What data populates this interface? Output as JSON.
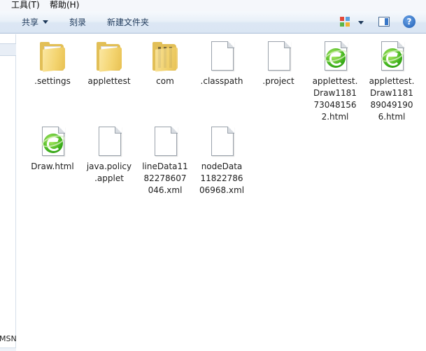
{
  "menu": {
    "tools": "工具(T)",
    "help": "帮助(H)"
  },
  "toolbar": {
    "share": "共享",
    "burn": "刻录",
    "new_folder": "新建文件夹"
  },
  "nav": {
    "msn_label": "MSN"
  },
  "files": [
    {
      "name": ".settings",
      "type": "folder"
    },
    {
      "name": "applettest",
      "type": "folder"
    },
    {
      "name": "com",
      "type": "folder"
    },
    {
      "name": ".classpath",
      "type": "doc"
    },
    {
      "name": ".project",
      "type": "doc"
    },
    {
      "name": "applettest.Draw11817304815 62.html",
      "display": "applettest.\nDraw1181\n73048156\n2.html",
      "type": "html"
    },
    {
      "name": "applettest.Draw11818904919 06.html",
      "display": "applettest.\nDraw1181\n89049190\n6.html",
      "type": "html"
    },
    {
      "name": "Draw.html",
      "type": "html"
    },
    {
      "name": "java.policy.applet",
      "display": "java.policy\n.applet",
      "type": "doc"
    },
    {
      "name": "lineData1182278607046.xml",
      "display": "lineData11\n82278607\n046.xml",
      "type": "doc"
    },
    {
      "name": "nodeData1182278606968.xml",
      "display": "nodeData\n11822786\n06968.xml",
      "type": "doc"
    }
  ],
  "icons": {
    "views": "views-icon",
    "preview_pane": "preview-pane-icon",
    "help": "help-icon"
  },
  "colors": {
    "toolbar_text": "#1e395b",
    "folder": "#f3d36e",
    "ie_green": "#3fb21c"
  }
}
